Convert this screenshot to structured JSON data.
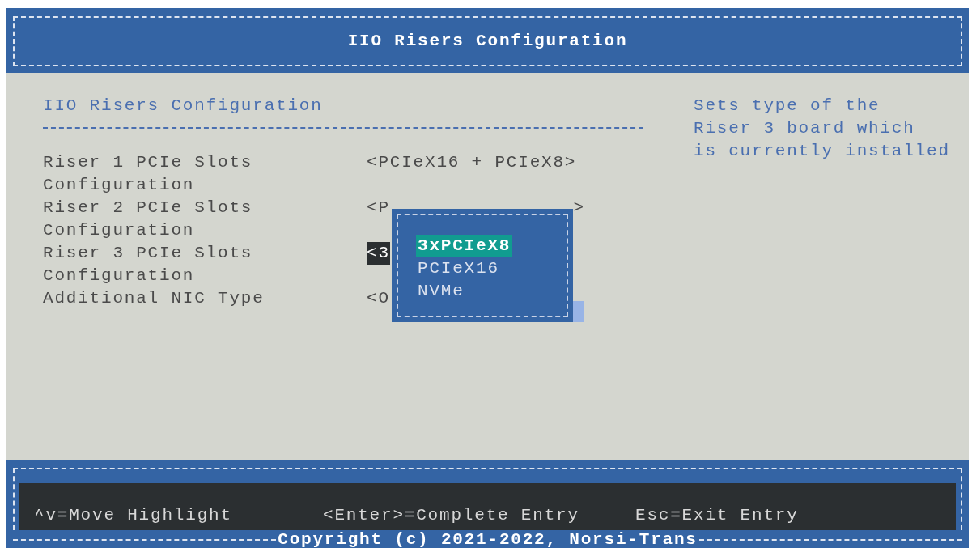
{
  "header": {
    "title": "IIO Risers Configuration"
  },
  "section_title": "IIO Risers Configuration",
  "help_text": [
    "Sets type of the",
    "Riser 3 board which",
    "is currently installed"
  ],
  "settings": [
    {
      "label": "Riser 1 PCIe Slots Configuration",
      "value": "<PCIeX16 + PCIeX8>",
      "selected": false
    },
    {
      "label": "Riser 2 PCIe Slots Configuration",
      "value": "<P",
      "value_end": ">",
      "selected": false
    },
    {
      "label": "Riser 3 PCIe Slots Configuration",
      "value": "<3",
      "selected": true
    },
    {
      "label": "Additional NIC Type",
      "value": "<O",
      "selected": false
    }
  ],
  "popup": {
    "options": [
      {
        "label": "3xPCIeX8",
        "selected": true
      },
      {
        "label": "PCIeX16",
        "selected": false
      },
      {
        "label": "NVMe",
        "selected": false
      }
    ]
  },
  "key_hints": [
    "^v=Move Highlight",
    "<Enter>=Complete Entry",
    "Esc=Exit Entry"
  ],
  "copyright": "Copyright (c) 2021-2022, Norsi-Trans"
}
